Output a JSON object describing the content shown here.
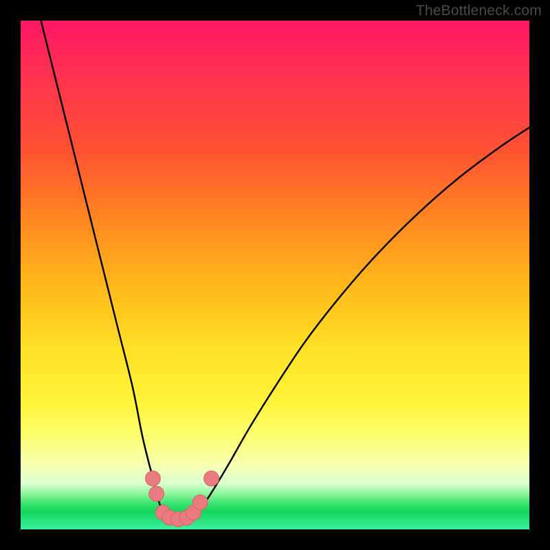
{
  "watermark": "TheBottleneck.com",
  "chart_data": {
    "type": "line",
    "title": "",
    "xlabel": "",
    "ylabel": "",
    "xlim": [
      0,
      100
    ],
    "ylim": [
      0,
      100
    ],
    "grid": false,
    "series": [
      {
        "name": "curve",
        "x": [
          4,
          7,
          10,
          13,
          16,
          19,
          22,
          24,
          26,
          27,
          28,
          29,
          30,
          31,
          32,
          33,
          34,
          36,
          38,
          41,
          45,
          50,
          56,
          63,
          70,
          78,
          86,
          94,
          100
        ],
        "y": [
          100,
          88,
          76,
          64,
          52,
          40,
          28,
          18,
          10,
          6,
          3.5,
          2.5,
          2,
          2,
          2,
          2.5,
          3,
          5,
          8,
          13,
          20,
          28,
          37,
          46,
          54,
          62,
          69,
          75,
          79
        ]
      }
    ],
    "markers": [
      {
        "name": "marker",
        "x": 26.0,
        "y": 10.0
      },
      {
        "name": "marker",
        "x": 26.7,
        "y": 7.0
      },
      {
        "name": "marker",
        "x": 28.0,
        "y": 3.3
      },
      {
        "name": "marker",
        "x": 29.3,
        "y": 2.3
      },
      {
        "name": "marker",
        "x": 31.0,
        "y": 2.0
      },
      {
        "name": "marker",
        "x": 32.7,
        "y": 2.3
      },
      {
        "name": "marker",
        "x": 34.0,
        "y": 3.3
      },
      {
        "name": "marker",
        "x": 35.3,
        "y": 5.3
      },
      {
        "name": "marker",
        "x": 37.5,
        "y": 10.0
      }
    ],
    "colors": {
      "curve": "#000000",
      "marker_fill": "#e77b7f",
      "marker_stroke": "#d46469"
    }
  }
}
